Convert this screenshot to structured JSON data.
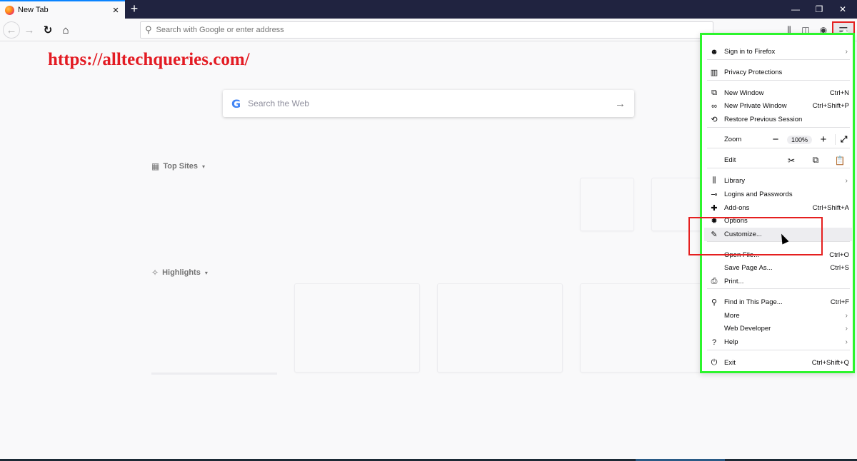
{
  "browser": {
    "tab": {
      "title": "New Tab",
      "close_label": "×"
    },
    "new_tab_label": "+",
    "window_controls": {
      "minimize": "—",
      "restore": "❐",
      "close": "✕"
    },
    "nav": {
      "back": "←",
      "forward": "→",
      "reload": "↻",
      "home": "⌂"
    },
    "urlbar": {
      "placeholder": "Search with Google or enter address",
      "value": ""
    },
    "toolbar_icons": {
      "library": "⫼",
      "sidebar": "◫",
      "account": "◉",
      "menu": "☰"
    }
  },
  "watermark": "https://alltechqueries.com/",
  "newtab": {
    "search": {
      "logo": "G",
      "placeholder": "Search the Web",
      "arrow": "→"
    },
    "top_sites": {
      "label": "Top Sites",
      "icon": "▦",
      "chevron": "▾"
    },
    "highlights": {
      "label": "Highlights",
      "icon": "✧",
      "chevron": "▾"
    }
  },
  "menu": {
    "items": [
      {
        "id": "sign-in",
        "icon": "☻",
        "label": "Sign in to Firefox",
        "shortcut": "",
        "submenu": true
      },
      {
        "id": "privacy",
        "icon": "▥",
        "label": "Privacy Protections",
        "shortcut": "",
        "submenu": false
      },
      {
        "id": "new-window",
        "icon": "⧉",
        "label": "New Window",
        "shortcut": "Ctrl+N",
        "submenu": false
      },
      {
        "id": "new-private-window",
        "icon": "∞",
        "label": "New Private Window",
        "shortcut": "Ctrl+Shift+P",
        "submenu": false
      },
      {
        "id": "restore-session",
        "icon": "⟲",
        "label": "Restore Previous Session",
        "shortcut": "",
        "submenu": false
      },
      {
        "id": "library",
        "icon": "⫼",
        "label": "Library",
        "shortcut": "",
        "submenu": true
      },
      {
        "id": "logins",
        "icon": "⊸",
        "label": "Logins and Passwords",
        "shortcut": "",
        "submenu": false
      },
      {
        "id": "addons",
        "icon": "✚",
        "label": "Add-ons",
        "shortcut": "Ctrl+Shift+A",
        "submenu": false
      },
      {
        "id": "options",
        "icon": "✹",
        "label": "Options",
        "shortcut": "",
        "submenu": false
      },
      {
        "id": "customize",
        "icon": "✎",
        "label": "Customize...",
        "shortcut": "",
        "submenu": false
      },
      {
        "id": "open-file",
        "icon": "",
        "label": "Open File...",
        "shortcut": "Ctrl+O",
        "submenu": false
      },
      {
        "id": "save-page",
        "icon": "",
        "label": "Save Page As...",
        "shortcut": "Ctrl+S",
        "submenu": false
      },
      {
        "id": "print",
        "icon": "⎙",
        "label": "Print...",
        "shortcut": "",
        "submenu": false
      },
      {
        "id": "find",
        "icon": "⚲",
        "label": "Find in This Page...",
        "shortcut": "Ctrl+F",
        "submenu": false
      },
      {
        "id": "more",
        "icon": "",
        "label": "More",
        "shortcut": "",
        "submenu": true
      },
      {
        "id": "web-developer",
        "icon": "",
        "label": "Web Developer",
        "shortcut": "",
        "submenu": true
      },
      {
        "id": "help",
        "icon": "?",
        "label": "Help",
        "shortcut": "",
        "submenu": true
      },
      {
        "id": "exit",
        "icon": "⏻",
        "label": "Exit",
        "shortcut": "Ctrl+Shift+Q",
        "submenu": false
      }
    ],
    "zoom": {
      "label": "Zoom",
      "minus": "−",
      "value": "100%",
      "plus": "+",
      "fullscreen": "⤢"
    },
    "edit": {
      "label": "Edit",
      "cut": "✂",
      "copy": "⧉",
      "paste": "📋"
    },
    "submenu_chevron": "›"
  }
}
